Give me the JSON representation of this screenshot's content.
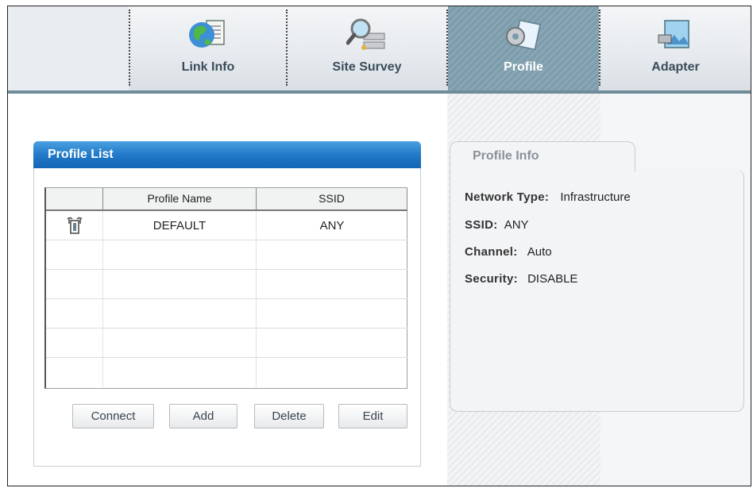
{
  "nav": {
    "tabs": [
      {
        "label": "Link Info",
        "icon": "globe-document-icon"
      },
      {
        "label": "Site Survey",
        "icon": "magnifier-network-icon"
      },
      {
        "label": "Profile",
        "icon": "gear-document-icon",
        "active": true
      },
      {
        "label": "Adapter",
        "icon": "adapter-card-icon"
      }
    ]
  },
  "profile_list": {
    "title": "Profile List",
    "columns": [
      "",
      "Profile Name",
      "SSID"
    ],
    "rows": [
      {
        "icon": "connected-adapter-icon",
        "name": "DEFAULT",
        "ssid": "ANY"
      },
      {
        "name": "",
        "ssid": ""
      },
      {
        "name": "",
        "ssid": ""
      },
      {
        "name": "",
        "ssid": ""
      },
      {
        "name": "",
        "ssid": ""
      },
      {
        "name": "",
        "ssid": ""
      }
    ],
    "buttons": {
      "connect": "Connect",
      "add": "Add",
      "delete": "Delete",
      "edit": "Edit"
    }
  },
  "profile_info": {
    "title": "Profile Info",
    "network_type_label": "Network Type:",
    "network_type_value": "Infrastructure",
    "ssid_label": "SSID:",
    "ssid_value": "ANY",
    "channel_label": "Channel:",
    "channel_value": "Auto",
    "security_label": "Security:",
    "security_value": "DISABLE"
  },
  "colors": {
    "header_blue": "#1f77c7",
    "active_tab": "#7d9cab"
  }
}
